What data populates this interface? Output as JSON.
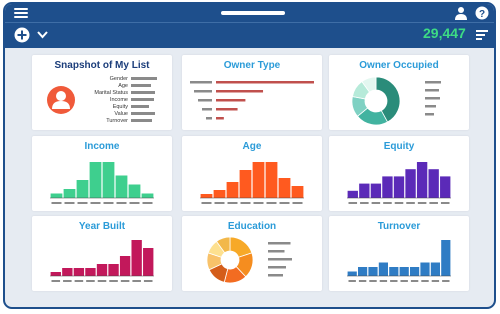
{
  "header": {
    "menu_icon": "hamburger-icon",
    "user_icon": "user-icon",
    "help_icon": "help-icon",
    "add_icon": "add-circle-icon",
    "dropdown_icon": "chevron-down-icon",
    "list_icon": "list-icon",
    "record_count": "29,447",
    "count_color": "#3ddc84",
    "bar_color": "#1e4f8c"
  },
  "cards": {
    "snapshot": {
      "title": "Snapshot of My List",
      "icon": "person-icon",
      "icon_color": "#f05a3a",
      "items": [
        "Gender",
        "Age",
        "Marital Status",
        "Income",
        "Equity",
        "Value",
        "Turnover"
      ],
      "bar_levels": [
        0.85,
        0.65,
        0.8,
        0.75,
        0.6,
        0.8,
        0.7
      ]
    },
    "owner_type": {
      "title": "Owner Type",
      "bar_levels": [
        1.0,
        0.48,
        0.3,
        0.22,
        0.08
      ],
      "color": "#c0504d"
    },
    "owner_occupied": {
      "title": "Owner Occupied",
      "slices": [
        0.42,
        0.22,
        0.14,
        0.12,
        0.1
      ],
      "colors": [
        "#2a8c7a",
        "#42b3a0",
        "#7fd1c3",
        "#b6ead9",
        "#e3f7f0"
      ]
    },
    "income": {
      "title": "Income",
      "values": [
        1,
        2,
        4,
        8,
        8,
        5,
        3,
        1
      ],
      "color": "#3ecf8e"
    },
    "age": {
      "title": "Age",
      "values": [
        1,
        2,
        4,
        7,
        9,
        9,
        5,
        3
      ],
      "color": "#ff5a1f"
    },
    "equity": {
      "title": "Equity",
      "values": [
        1,
        2,
        2,
        3,
        3,
        4,
        5,
        4,
        3
      ],
      "color": "#5b2ab8"
    },
    "year_built": {
      "title": "Year Built",
      "values": [
        1,
        2,
        2,
        2,
        3,
        3,
        5,
        9,
        7
      ],
      "color": "#c2185b"
    },
    "education": {
      "title": "Education",
      "slices": [
        0.2,
        0.18,
        0.16,
        0.14,
        0.12,
        0.1,
        0.1
      ],
      "colors": [
        "#f7a928",
        "#f58d1f",
        "#f36c21",
        "#d45d1a",
        "#f8c26a",
        "#fde08f",
        "#f2b84b"
      ]
    },
    "turnover": {
      "title": "Turnover",
      "values": [
        1,
        2,
        2,
        3,
        2,
        2,
        2,
        3,
        3,
        8
      ],
      "color": "#2f7cc4"
    }
  }
}
